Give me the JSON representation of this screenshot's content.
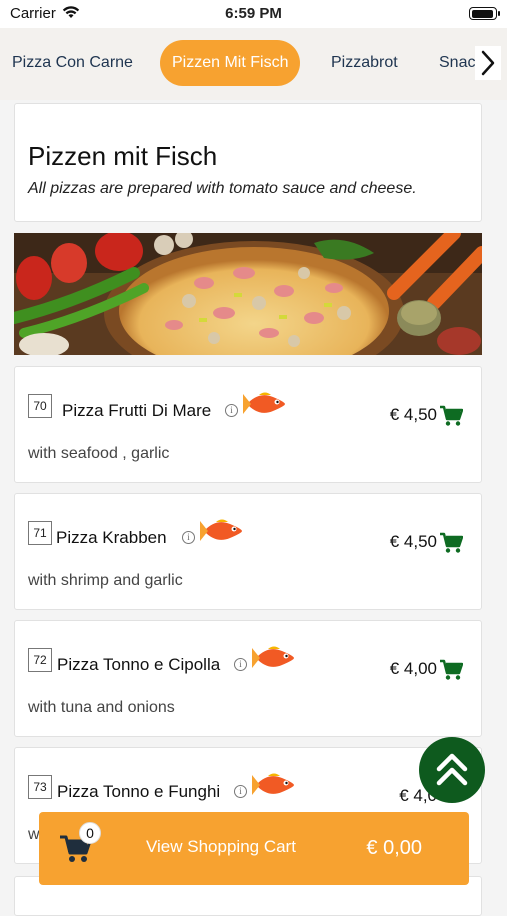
{
  "status": {
    "carrier": "Carrier",
    "time": "6:59 PM"
  },
  "tabs": [
    {
      "label": "Pizza Con Carne",
      "active": false
    },
    {
      "label": "Pizzen Mit Fisch",
      "active": true
    },
    {
      "label": "Pizzabrot",
      "active": false
    },
    {
      "label": "Snac",
      "active": false
    }
  ],
  "category": {
    "title": "Pizzen mit Fisch",
    "subtitle": "All pizzas are prepared with tomato sauce and cheese."
  },
  "items": [
    {
      "number": "70",
      "name": "Pizza Frutti Di Mare",
      "price": "€ 4,50",
      "description": "with seafood , garlic"
    },
    {
      "number": "71",
      "name": "Pizza Krabben",
      "price": "€ 4,50",
      "description": "with shrimp and garlic"
    },
    {
      "number": "72",
      "name": "Pizza Tonno e Cipolla",
      "price": "€ 4,00",
      "description": "with tuna and onions"
    },
    {
      "number": "73",
      "name": "Pizza Tonno e Funghi",
      "price": "€ 4,0",
      "description": "w"
    }
  ],
  "cart": {
    "count": "0",
    "label": "View Shopping Cart",
    "total": "€ 0,00"
  },
  "icons": {
    "info": "info-icon",
    "fish": "fish-icon",
    "cart": "cart-icon",
    "scroll_top": "double-chevron-up-icon",
    "tab_next": "chevron-right-icon"
  },
  "colors": {
    "accent": "#f7a230",
    "cart_green": "#0e6b22",
    "fab_green": "#0e5a1e"
  }
}
